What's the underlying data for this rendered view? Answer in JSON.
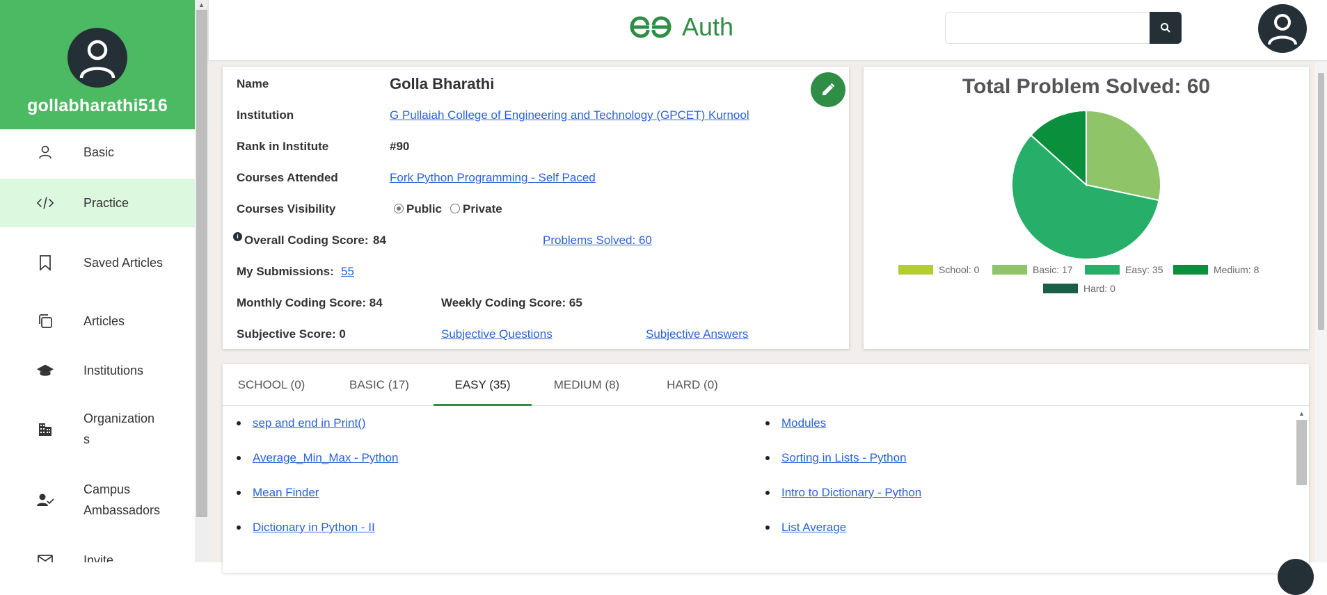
{
  "sidebar": {
    "username": "gollabharathi516",
    "items": [
      {
        "label": "Basic",
        "icon": "user-icon"
      },
      {
        "label": "Practice",
        "icon": "code-icon"
      },
      {
        "label": "Saved Articles",
        "icon": "bookmark-icon"
      },
      {
        "label": "Articles",
        "icon": "copy-icon"
      },
      {
        "label": "Institutions",
        "icon": "school-icon"
      },
      {
        "label": "Organizations",
        "icon": "building-icon"
      },
      {
        "label": "Campus Ambassadors",
        "icon": "user-check-icon"
      },
      {
        "label": "Invite",
        "icon": "mail-icon"
      }
    ],
    "active_item": "Practice",
    "accent": "#4cb963"
  },
  "header": {
    "logo_text": "Auth",
    "search_placeholder": ""
  },
  "profile": {
    "name_label": "Name",
    "name_value": "Golla Bharathi",
    "institution_label": "Institution",
    "institution_value": "G Pullaiah College of Engineering and Technology (GPCET) Kurnool",
    "rank_label": "Rank in Institute",
    "rank_value": "#90",
    "courses_label": "Courses Attended",
    "courses_value": "Fork Python Programming - Self Paced",
    "visibility_label": "Courses Visibility",
    "visibility_public": "Public",
    "visibility_private": "Private",
    "visibility_selected": "Public",
    "overall_label": "Overall Coding Score:",
    "overall_value": "84",
    "problems_solved_link": "Problems Solved: 60",
    "submissions_label": "My Submissions:",
    "submissions_value": "55",
    "monthly_label": "Monthly Coding Score: 84",
    "weekly_label": "Weekly Coding Score: 65",
    "subjective_label": "Subjective Score: 0",
    "subjective_questions": "Subjective Questions",
    "subjective_answers": "Subjective Answers"
  },
  "chart_data": {
    "type": "pie",
    "title": "Total Problem Solved: 60",
    "categories": [
      "School",
      "Basic",
      "Easy",
      "Medium",
      "Hard"
    ],
    "values": [
      0,
      17,
      35,
      8,
      0
    ],
    "legend_labels": [
      "School: 0",
      "Basic: 17",
      "Easy: 35",
      "Medium: 8",
      "Hard: 0"
    ],
    "colors": [
      "#b5cc34",
      "#8fc468",
      "#27ae68",
      "#0a8f3c",
      "#1b5e47"
    ],
    "legend_position": "bottom"
  },
  "tabs": [
    {
      "label": "SCHOOL (0)"
    },
    {
      "label": "BASIC (17)"
    },
    {
      "label": "EASY (35)"
    },
    {
      "label": "MEDIUM (8)"
    },
    {
      "label": "HARD (0)"
    }
  ],
  "active_tab": "EASY (35)",
  "problems_left": [
    "sep and end in Print()",
    "Average_Min_Max - Python",
    "Mean Finder",
    "Dictionary in Python - II"
  ],
  "problems_right": [
    "Modules",
    "Sorting in Lists - Python",
    "Intro to Dictionary - Python",
    "List Average"
  ]
}
